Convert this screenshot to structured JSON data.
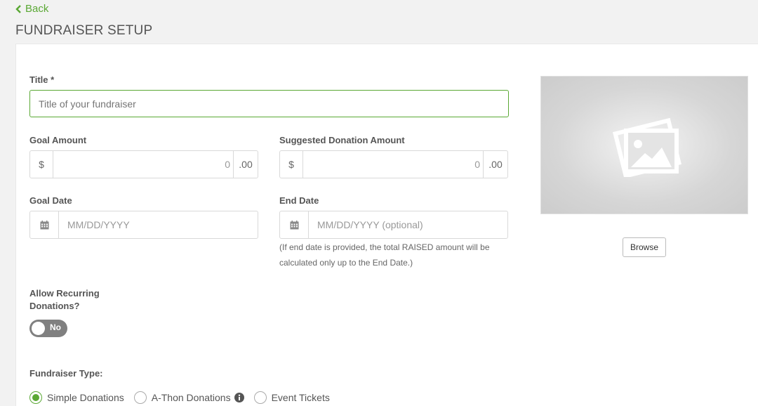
{
  "nav": {
    "back_label": "Back"
  },
  "page": {
    "title": "FUNDRAISER SETUP"
  },
  "form": {
    "title": {
      "label": "Title *",
      "placeholder": "Title of your fundraiser"
    },
    "goal_amount": {
      "label": "Goal Amount",
      "prefix": "$",
      "value": "0",
      "suffix": ".00"
    },
    "suggested_amount": {
      "label": "Suggested Donation Amount",
      "prefix": "$",
      "value": "0",
      "suffix": ".00"
    },
    "goal_date": {
      "label": "Goal Date",
      "placeholder": "MM/DD/YYYY"
    },
    "end_date": {
      "label": "End Date",
      "placeholder": "MM/DD/YYYY (optional)",
      "hint": "(If end date is provided, the total RAISED amount will be calculated only up to the End Date.)"
    },
    "recurring": {
      "label": "Allow Recurring Donations?",
      "toggle_text": "No"
    },
    "fundraiser_type": {
      "label": "Fundraiser Type:",
      "options": [
        "Simple Donations",
        "A-Thon Donations",
        "Event Tickets"
      ],
      "selected": "Simple Donations"
    }
  },
  "image": {
    "browse_label": "Browse"
  },
  "colors": {
    "accent": "#5aa834",
    "toggle_off": "#808080"
  }
}
